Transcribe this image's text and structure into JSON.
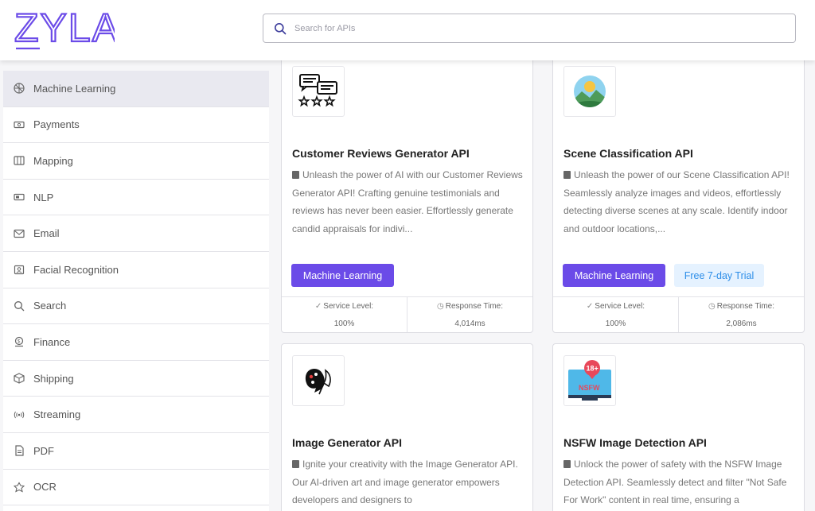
{
  "app": {
    "logo_text": "ZYLA",
    "brand_color": "#6b4be8"
  },
  "search": {
    "placeholder": "Search for APIs",
    "value": ""
  },
  "sidebar": {
    "items": [
      {
        "label": "Machine Learning",
        "icon": "ml-icon",
        "active": true
      },
      {
        "label": "Payments",
        "icon": "payments-icon"
      },
      {
        "label": "Mapping",
        "icon": "map-icon"
      },
      {
        "label": "NLP",
        "icon": "nlp-icon"
      },
      {
        "label": "Email",
        "icon": "email-icon"
      },
      {
        "label": "Facial Recognition",
        "icon": "face-icon"
      },
      {
        "label": "Search",
        "icon": "search-icon"
      },
      {
        "label": "Finance",
        "icon": "finance-icon"
      },
      {
        "label": "Shipping",
        "icon": "shipping-icon"
      },
      {
        "label": "Streaming",
        "icon": "streaming-icon"
      },
      {
        "label": "PDF",
        "icon": "pdf-icon"
      },
      {
        "label": "OCR",
        "icon": "ocr-icon"
      }
    ]
  },
  "cards": [
    {
      "title": "Customer Reviews Generator API",
      "icon": "reviews-icon",
      "description": "Unleash the power of AI with our Customer Reviews Generator API! Crafting genuine testimonials and reviews has never been easier. Effortlessly generate candid appraisals for indivi...",
      "tags": [
        "Machine Learning"
      ],
      "service_level_label": "Service Level:",
      "service_level": "100%",
      "response_time_label": "Response Time:",
      "response_time": "4,014ms"
    },
    {
      "title": "Scene Classification API",
      "icon": "landscape-icon",
      "description": "Unleash the power of our Scene Classification API! Seamlessly analyze images and videos, effortlessly detecting diverse scenes at any scale. Identify indoor and outdoor locations,...",
      "tags": [
        "Machine Learning",
        "Free 7-day Trial"
      ],
      "service_level_label": "Service Level:",
      "service_level": "100%",
      "response_time_label": "Response Time:",
      "response_time": "2,086ms"
    },
    {
      "title": "Image Generator API",
      "icon": "art-icon",
      "description": "Ignite your creativity with the Image Generator API. Our AI-driven art and image generator empowers developers and designers to"
    },
    {
      "title": "NSFW Image Detection API",
      "icon": "nsfw-icon",
      "badge": "18+",
      "badge_text": "NSFW",
      "description": "Unlock the power of safety with the NSFW Image Detection API. Seamlessly detect and filter \"Not Safe For Work\" content in real time, ensuring a"
    }
  ]
}
